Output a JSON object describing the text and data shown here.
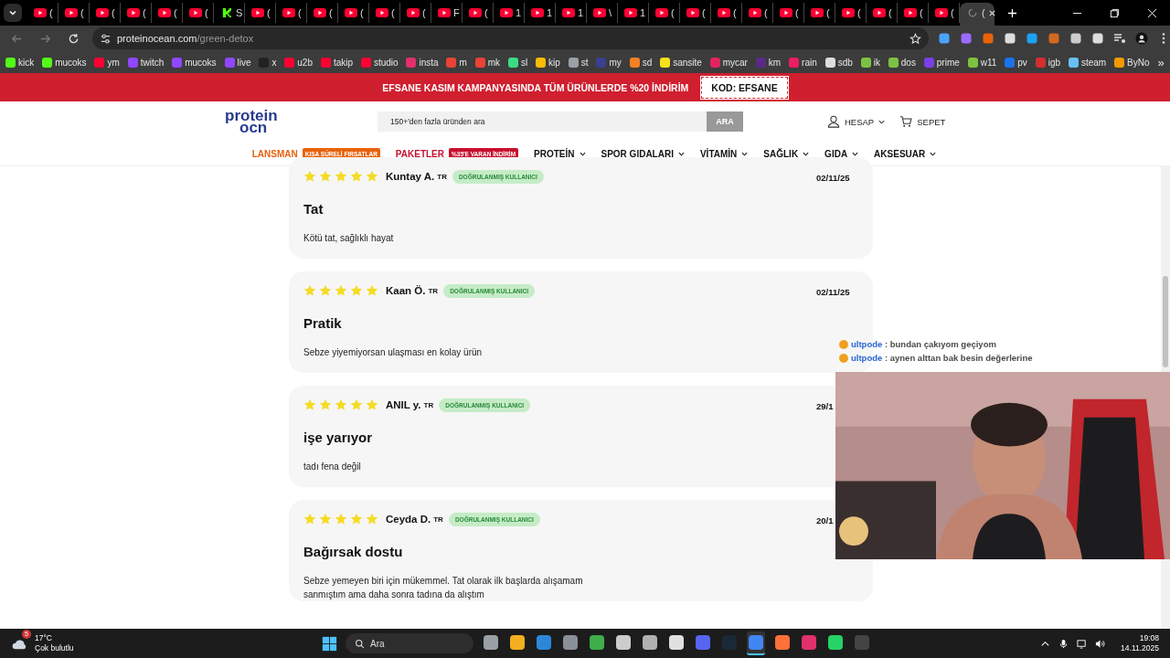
{
  "browser": {
    "tabs": [
      {
        "kind": "youtube",
        "title": "(",
        "selected": false
      },
      {
        "kind": "youtube",
        "title": "(",
        "selected": false
      },
      {
        "kind": "youtube",
        "title": "(",
        "selected": false
      },
      {
        "kind": "youtube",
        "title": "(",
        "selected": false
      },
      {
        "kind": "youtube",
        "title": "(",
        "selected": false
      },
      {
        "kind": "youtube",
        "title": "(",
        "selected": false
      },
      {
        "kind": "kick",
        "title": "S",
        "selected": false
      },
      {
        "kind": "youtube",
        "title": "(",
        "selected": false
      },
      {
        "kind": "youtube",
        "title": "(",
        "selected": false
      },
      {
        "kind": "youtube",
        "title": "(",
        "selected": false
      },
      {
        "kind": "youtube",
        "title": "(",
        "selected": false
      },
      {
        "kind": "youtube",
        "title": "(",
        "selected": false
      },
      {
        "kind": "youtube",
        "title": "(",
        "selected": false
      },
      {
        "kind": "youtube",
        "title": "F",
        "selected": false
      },
      {
        "kind": "youtube",
        "title": "(",
        "selected": false
      },
      {
        "kind": "youtube",
        "title": "1",
        "selected": false
      },
      {
        "kind": "youtube",
        "title": "1",
        "selected": false
      },
      {
        "kind": "youtube",
        "title": "1",
        "selected": false
      },
      {
        "kind": "youtube",
        "title": "\\",
        "selected": false
      },
      {
        "kind": "youtube",
        "title": "1",
        "selected": false
      },
      {
        "kind": "youtube",
        "title": "(",
        "selected": false
      },
      {
        "kind": "youtube",
        "title": "(",
        "selected": false
      },
      {
        "kind": "youtube",
        "title": "(",
        "selected": false
      },
      {
        "kind": "youtube",
        "title": "(",
        "selected": false
      },
      {
        "kind": "youtube",
        "title": "(",
        "selected": false
      },
      {
        "kind": "youtube",
        "title": "(",
        "selected": false
      },
      {
        "kind": "youtube",
        "title": "(",
        "selected": false
      },
      {
        "kind": "youtube",
        "title": "(",
        "selected": false
      },
      {
        "kind": "youtube",
        "title": "(",
        "selected": false
      },
      {
        "kind": "youtube",
        "title": "(",
        "selected": false
      },
      {
        "kind": "loading",
        "title": "(",
        "selected": true
      }
    ],
    "address": {
      "host": "proteinocean.com",
      "path": "/green-detox"
    },
    "bookmarks": [
      {
        "label": "kick",
        "color": "#53fc18"
      },
      {
        "label": "mucoks",
        "color": "#53fc18"
      },
      {
        "label": "ym",
        "color": "#ff0033"
      },
      {
        "label": "twitch",
        "color": "#9146ff"
      },
      {
        "label": "mucoks",
        "color": "#9146ff"
      },
      {
        "label": "live",
        "color": "#9146ff"
      },
      {
        "label": "x",
        "color": "#222222"
      },
      {
        "label": "u2b",
        "color": "#ff0033"
      },
      {
        "label": "takip",
        "color": "#ff0033"
      },
      {
        "label": "studio",
        "color": "#ff0033"
      },
      {
        "label": "insta",
        "color": "#e1306c"
      },
      {
        "label": "m",
        "color": "#ea4335"
      },
      {
        "label": "mk",
        "color": "#ea4335"
      },
      {
        "label": "sl",
        "color": "#3ddc84"
      },
      {
        "label": "kip",
        "color": "#fbbc04"
      },
      {
        "label": "st",
        "color": "#9aa0a6"
      },
      {
        "label": "my",
        "color": "#3b3f8f"
      },
      {
        "label": "sd",
        "color": "#f48024"
      },
      {
        "label": "sansite",
        "color": "#f7e018"
      },
      {
        "label": "mycar",
        "color": "#e0245e"
      },
      {
        "label": "km",
        "color": "#5b2a86"
      },
      {
        "label": "rain",
        "color": "#e91e63"
      },
      {
        "label": "sdb",
        "color": "#dddddd"
      },
      {
        "label": "ik",
        "color": "#7cc242"
      },
      {
        "label": "dos",
        "color": "#7cc242"
      },
      {
        "label": "prime",
        "color": "#7b3fe4"
      },
      {
        "label": "w11",
        "color": "#7cc242"
      },
      {
        "label": "pv",
        "color": "#1a73e8"
      },
      {
        "label": "igb",
        "color": "#d32f2f"
      },
      {
        "label": "steam",
        "color": "#66c0f4"
      },
      {
        "label": "ByNo",
        "color": "#f29900"
      }
    ],
    "more_bookmarks": "»"
  },
  "promo": {
    "text": "EFSANE KASIM KAMPANYASINDA TÜM ÜRÜNLERDE %20 İNDİRİM",
    "code": "KOD: EFSANE"
  },
  "header": {
    "logo_top": "protein",
    "logo_bottom": "ocn",
    "search_placeholder": "150+'den fazla üründen ara",
    "search_button": "ARA",
    "account": "HESAP",
    "cart": "SEPET"
  },
  "nav": [
    {
      "label": "LANSMAN",
      "color": "#e8620c",
      "badge": "KISA SÜRELİ FIRSATLAR",
      "dropdown": false
    },
    {
      "label": "PAKETLER",
      "color": "#c8102e",
      "badge": "%35'E VARAN İNDİRİM",
      "dropdown": false
    },
    {
      "label": "PROTEİN",
      "dropdown": true
    },
    {
      "label": "SPOR GIDALARI",
      "dropdown": true
    },
    {
      "label": "VİTAMİN",
      "dropdown": true
    },
    {
      "label": "SAĞLIK",
      "dropdown": true
    },
    {
      "label": "GIDA",
      "dropdown": true
    },
    {
      "label": "AKSESUAR",
      "dropdown": true
    }
  ],
  "reviews": [
    {
      "stars": 5,
      "name": "Kuntay A.",
      "country": "TR",
      "badge": "DOĞRULANMIŞ KULLANICI",
      "date": "02/11/25",
      "title": "Tat",
      "body": "Kötü tat, sağlıklı hayat"
    },
    {
      "stars": 5,
      "name": "Kaan Ö.",
      "country": "TR",
      "badge": "DOĞRULANMIŞ KULLANICI",
      "date": "02/11/25",
      "title": "Pratik",
      "body": "Sebze yiyemiyorsan ulaşması en kolay ürün"
    },
    {
      "stars": 5,
      "name": "ANIL y.",
      "country": "TR",
      "badge": "DOĞRULANMIŞ KULLANICI",
      "date": "29/1",
      "title": "işe yarıyor",
      "body": "tadı fena değil"
    },
    {
      "stars": 5,
      "name": "Ceyda D.",
      "country": "TR",
      "badge": "DOĞRULANMIŞ KULLANICI",
      "date": "20/1",
      "title": "Bağırsak dostu",
      "body": "Sebze yemeyen biri için mükemmel. Tat olarak ilk başlarda alışamam sanmıştım ama daha sonra tadına da alıştım"
    }
  ],
  "stream_chat": [
    {
      "user": "ultpode",
      "message": ": bundan çakıyom geçiyom"
    },
    {
      "user": "ultpode",
      "message": ": aynen alttan bak besin değerlerine"
    }
  ],
  "taskbar": {
    "weather_temp": "17°C",
    "weather_text": "Çok bulutlu",
    "weather_badge": "5",
    "search": "Ara",
    "apps": [
      {
        "color": "#9aa0a6",
        "selected": false
      },
      {
        "color": "#f2b01e",
        "selected": false
      },
      {
        "color": "#2b88d8",
        "selected": false
      },
      {
        "color": "#8a8f98",
        "selected": false
      },
      {
        "color": "#3fae49",
        "selected": false
      },
      {
        "color": "#cccccc",
        "selected": false
      },
      {
        "color": "#b0b0b0",
        "selected": false
      },
      {
        "color": "#e0e0e0",
        "selected": false
      },
      {
        "color": "#5865f2",
        "selected": false
      },
      {
        "color": "#1b2838",
        "selected": false
      },
      {
        "color": "#4285f4",
        "selected": true
      },
      {
        "color": "#ff7139",
        "selected": false
      },
      {
        "color": "#e1306c",
        "selected": false
      },
      {
        "color": "#25d366",
        "selected": false
      },
      {
        "color": "#444444",
        "selected": false
      }
    ],
    "time": "19:08",
    "date": "14.11.2025"
  }
}
